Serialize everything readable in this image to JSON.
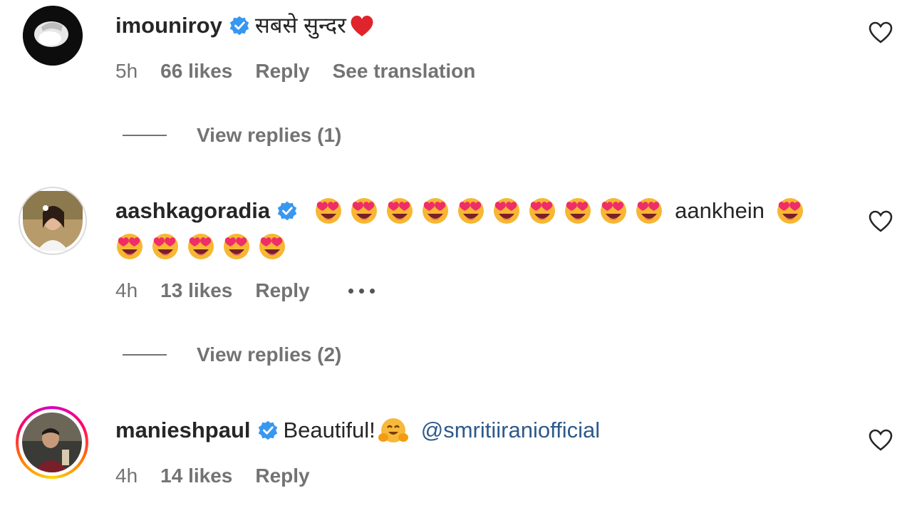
{
  "colors": {
    "verified": "#3897f0",
    "meta": "#737373",
    "mention": "#2e5a8a",
    "heart": "#262626"
  },
  "comments": [
    {
      "username": "imouniroy",
      "text": "सबसे सुन्दर",
      "emoji": "red-heart",
      "time": "5h",
      "likes": "66 likes",
      "reply": "Reply",
      "translation": "See translation",
      "view_replies": "View replies (1)"
    },
    {
      "username": "aashkagoradia",
      "text": "aankhein",
      "emoji": "smiling-face-with-heart-eyes",
      "time": "4h",
      "likes": "13 likes",
      "reply": "Reply",
      "view_replies": "View replies (2)"
    },
    {
      "username": "manieshpaul",
      "text": "Beautiful!",
      "emoji": "hugging-face",
      "mention": "@smritiiraniofficial",
      "time": "4h",
      "likes": "14 likes",
      "reply": "Reply"
    }
  ]
}
